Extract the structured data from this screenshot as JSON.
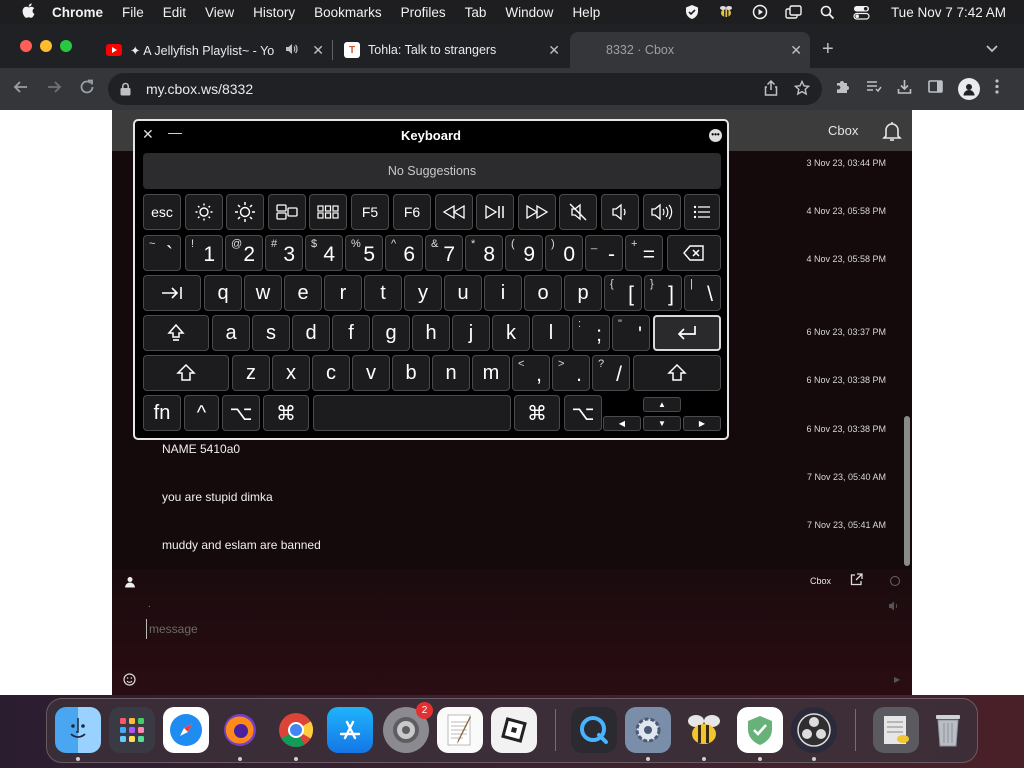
{
  "menubar": {
    "app": "Chrome",
    "items": [
      "File",
      "Edit",
      "View",
      "History",
      "Bookmarks",
      "Profiles",
      "Tab",
      "Window",
      "Help"
    ],
    "clock": "Tue Nov 7  7:42 AM"
  },
  "tabs": [
    {
      "title": "✦ A Jellyfish Playlist~ - Yo",
      "favicon": "youtube"
    },
    {
      "title": "Tohla: Talk to strangers",
      "favicon": "T"
    },
    {
      "title": "8332 · Cbox",
      "favicon": "none"
    }
  ],
  "address": {
    "url": "my.cbox.ws/8332"
  },
  "cbox": {
    "brand": "Cbox",
    "messages": [
      {
        "time": "3 Nov 23, 03:44 PM",
        "text": ""
      },
      {
        "time": "4 Nov 23, 05:58 PM",
        "text": ""
      },
      {
        "time": "4 Nov 23, 05:58 PM",
        "text": ""
      },
      {
        "time": "6 Nov 23, 03:37 PM",
        "text": ""
      },
      {
        "time": "6 Nov 23, 03:38 PM",
        "text": ""
      },
      {
        "time": "6 Nov 23, 03:38 PM",
        "text": "NAME 5410a0"
      },
      {
        "time": "7 Nov 23, 05:40 AM",
        "text": "you are stupid dimka"
      },
      {
        "time": "7 Nov 23, 05:41 AM",
        "text": "muddy and eslam are banned"
      }
    ],
    "footer_brand": "Cbox",
    "name_placeholder": ".",
    "message_placeholder": "message"
  },
  "keyboard": {
    "title": "Keyboard",
    "suggestions": "No Suggestions",
    "fn_row": [
      "esc",
      "F5",
      "F6"
    ],
    "number_row": [
      {
        "shift": "~",
        "main": "`"
      },
      {
        "shift": "!",
        "main": "1"
      },
      {
        "shift": "@",
        "main": "2"
      },
      {
        "shift": "#",
        "main": "3"
      },
      {
        "shift": "$",
        "main": "4"
      },
      {
        "shift": "%",
        "main": "5"
      },
      {
        "shift": "^",
        "main": "6"
      },
      {
        "shift": "&",
        "main": "7"
      },
      {
        "shift": "*",
        "main": "8"
      },
      {
        "shift": "(",
        "main": "9"
      },
      {
        "shift": ")",
        "main": "0"
      },
      {
        "shift": "_",
        "main": "-"
      },
      {
        "shift": "+",
        "main": "="
      }
    ],
    "row_q": [
      "q",
      "w",
      "e",
      "r",
      "t",
      "y",
      "u",
      "i",
      "o",
      "p"
    ],
    "row_q_punct": [
      {
        "shift": "{",
        "main": "["
      },
      {
        "shift": "}",
        "main": "]"
      },
      {
        "shift": "|",
        "main": "\\"
      }
    ],
    "row_a": [
      "a",
      "s",
      "d",
      "f",
      "g",
      "h",
      "j",
      "k",
      "l"
    ],
    "row_a_punct": [
      {
        "shift": ":",
        "main": ";"
      },
      {
        "shift": "\"",
        "main": "'"
      }
    ],
    "row_z": [
      "z",
      "x",
      "c",
      "v",
      "b",
      "n",
      "m"
    ],
    "row_z_punct": [
      {
        "shift": "<",
        "main": ","
      },
      {
        "shift": ">",
        "main": "."
      },
      {
        "shift": "?",
        "main": "/"
      }
    ],
    "bottom": {
      "fn": "fn",
      "control": "^",
      "option": "⌥",
      "command": "⌘"
    }
  },
  "dock": {
    "settings_badge": "2"
  },
  "colors": {
    "accent_red": "#e5302f",
    "page_bg": "#140a0c"
  }
}
